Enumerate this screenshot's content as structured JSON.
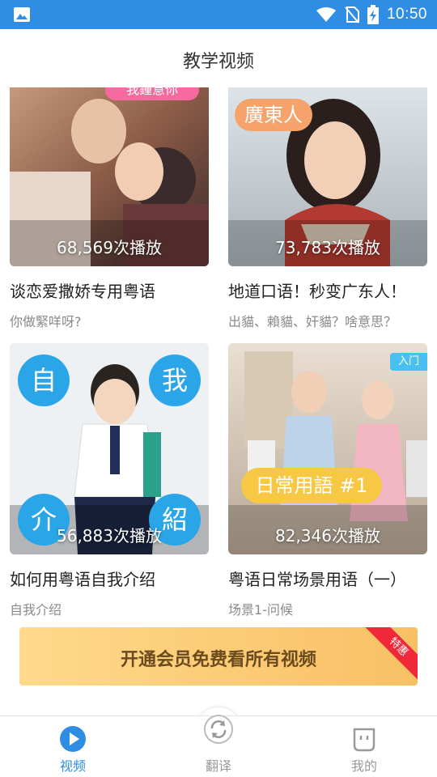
{
  "status_bar": {
    "time": "10:50"
  },
  "header": {
    "title": "教学视频"
  },
  "videos": [
    {
      "plays": "68,569次播放",
      "title": "谈恋爱撒娇专用粤语",
      "subtitle": "你做緊咩呀?",
      "thumb_banner": "我鍾意你",
      "thumb_tags": []
    },
    {
      "plays": "73,783次播放",
      "title": "地道口语！秒变广东人！",
      "subtitle": "出貓、賴貓、奸貓？啥意思？",
      "thumb_banner": "廣東人",
      "thumb_tags": []
    },
    {
      "plays": "56,883次播放",
      "title": "如何用粤语自我介绍",
      "subtitle": "自我介绍",
      "thumb_tags": [
        "自",
        "我",
        "介",
        "紹"
      ]
    },
    {
      "plays": "82,346次播放",
      "title": "粤语日常场景用语（一）",
      "subtitle": "场景1-问候",
      "thumb_banner": "日常用語 #1",
      "badge": "入门"
    }
  ],
  "vip_banner": {
    "label": "开通会员免费看所有视频",
    "ribbon": "特惠"
  },
  "bottom_nav": [
    {
      "label": "视频",
      "icon": "play-icon",
      "active": true
    },
    {
      "label": "翻译",
      "icon": "translate-icon",
      "active": false
    },
    {
      "label": "我的",
      "icon": "profile-icon",
      "active": false
    }
  ],
  "colors": {
    "primary": "#2f8de4",
    "vip_gold": "#f8c064",
    "ribbon_red": "#f0293a",
    "badge_blue": "#49c0f0"
  }
}
